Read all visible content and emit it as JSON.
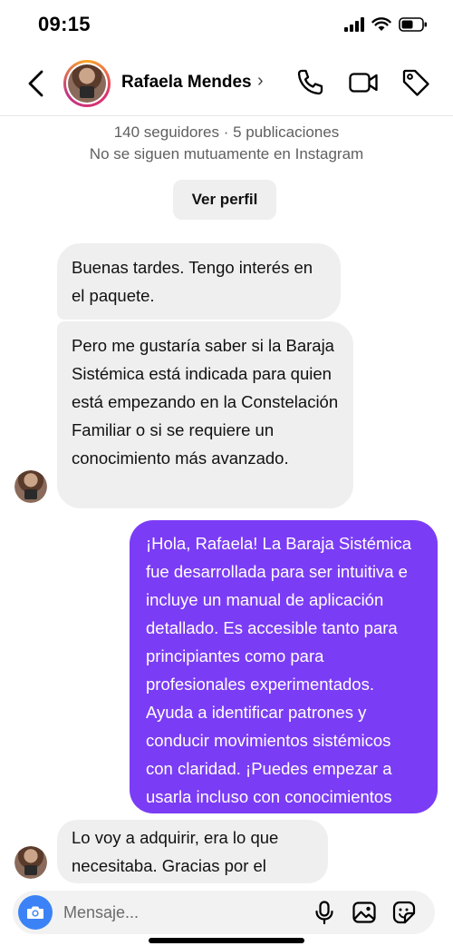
{
  "status_bar": {
    "time": "09:15"
  },
  "header": {
    "contact_name": "Rafaela Mendes",
    "chevron": "›"
  },
  "profile": {
    "stats": "140 seguidores · 5 publicaciones",
    "mutual": "No se siguen mutuamente en Instagram",
    "view_profile_label": "Ver perfil"
  },
  "messages": [
    {
      "sender": "contact",
      "text": "Buenas tardes. Tengo interés en el paquete."
    },
    {
      "sender": "contact",
      "text": "Pero me gustaría saber si la Baraja Sistémica está indicada para quien está empezando en la Constelación Familiar o si se requiere un conocimiento más avanzado."
    },
    {
      "sender": "me",
      "text": "¡Hola, Rafaela! La Baraja Sistémica fue desarrollada para ser intuitiva e incluye un manual de aplicación detallado. Es accesible tanto para principiantes como para profesionales experimentados. Ayuda a identificar patrones y conducir movimientos sistémicos con claridad. ¡Puedes empezar a usarla incluso con conocimientos básicos!"
    },
    {
      "sender": "contact",
      "text": "Lo voy a adquirir, era lo que necesitaba. Gracias por el apoyo."
    }
  ],
  "composer": {
    "placeholder": "Mensaje..."
  },
  "icons": {
    "back": "chevron-left-icon",
    "call": "phone-icon",
    "video": "video-camera-icon",
    "tag": "tag-icon",
    "camera": "camera-icon",
    "mic": "microphone-icon",
    "gallery": "image-icon",
    "sticker": "sticker-icon"
  },
  "colors": {
    "outgoing_bubble": "#7b3cf5",
    "incoming_bubble": "#efefef",
    "camera_button": "#3b82f6"
  }
}
